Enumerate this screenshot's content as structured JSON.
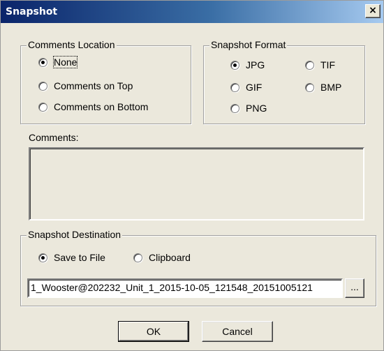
{
  "window": {
    "title": "Snapshot",
    "close_label": "×"
  },
  "comments_location": {
    "legend": "Comments Location",
    "options": [
      {
        "label": "None",
        "checked": true
      },
      {
        "label": "Comments on Top",
        "checked": false
      },
      {
        "label": "Comments on Bottom",
        "checked": false
      }
    ]
  },
  "snapshot_format": {
    "legend": "Snapshot Format",
    "options": [
      {
        "label": "JPG",
        "checked": true
      },
      {
        "label": "TIF",
        "checked": false
      },
      {
        "label": "GIF",
        "checked": false
      },
      {
        "label": "BMP",
        "checked": false
      },
      {
        "label": "PNG",
        "checked": false
      }
    ]
  },
  "comments": {
    "label": "Comments:",
    "value": ""
  },
  "snapshot_destination": {
    "legend": "Snapshot Destination",
    "options": [
      {
        "label": "Save to File",
        "checked": true
      },
      {
        "label": "Clipboard",
        "checked": false
      }
    ],
    "file_path": "1_Wooster@202232_Unit_1_2015-10-05_121548_20151005121",
    "browse_label": "..."
  },
  "buttons": {
    "ok_label": "OK",
    "cancel_label": "Cancel"
  }
}
